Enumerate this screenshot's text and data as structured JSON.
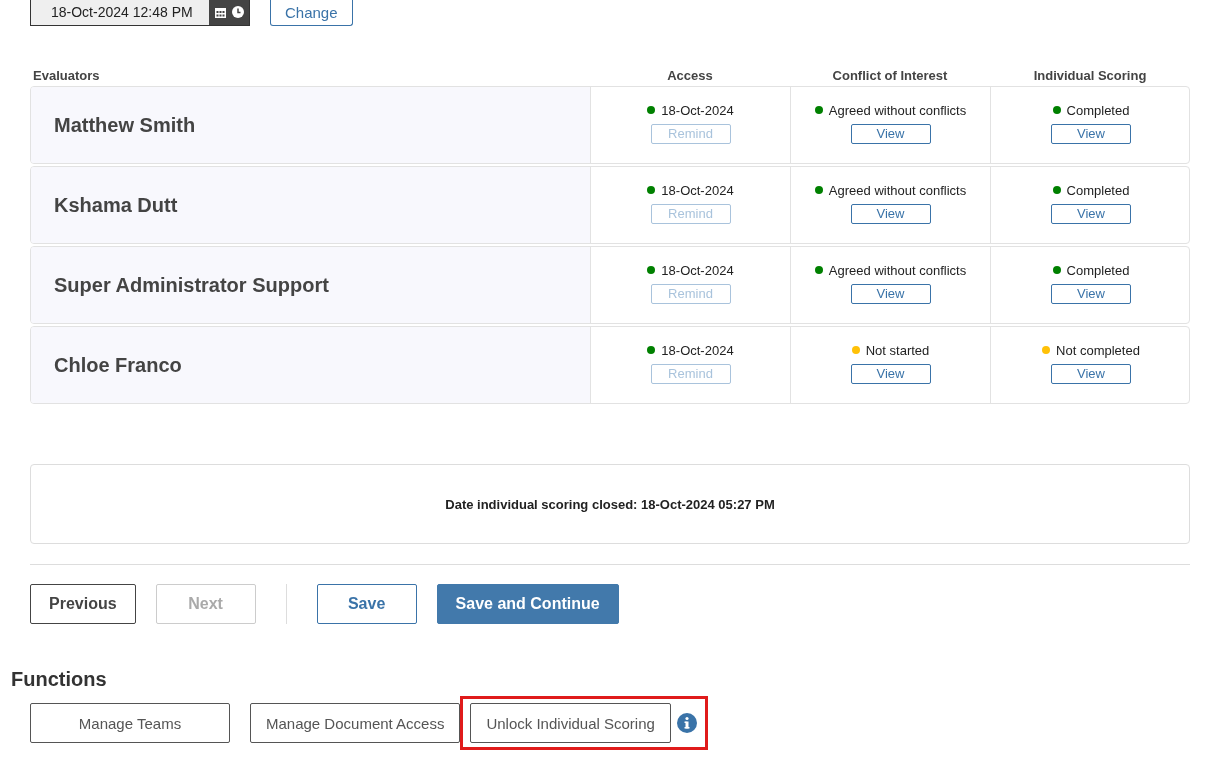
{
  "date_field": {
    "value": "18-Oct-2024 12:48 PM"
  },
  "change_button": "Change",
  "columns": [
    "Evaluators",
    "Access",
    "Conflict of Interest",
    "Individual Scoring"
  ],
  "evaluators": [
    {
      "name": "Matthew Smith",
      "access": {
        "status": "18-Oct-2024",
        "color": "#008000",
        "button": "Remind",
        "disabled": true
      },
      "conflict": {
        "status": "Agreed without conflicts",
        "color": "#008000",
        "button": "View",
        "disabled": false
      },
      "scoring": {
        "status": "Completed",
        "color": "#008000",
        "button": "View",
        "disabled": false
      }
    },
    {
      "name": "Kshama Dutt",
      "access": {
        "status": "18-Oct-2024",
        "color": "#008000",
        "button": "Remind",
        "disabled": true
      },
      "conflict": {
        "status": "Agreed without conflicts",
        "color": "#008000",
        "button": "View",
        "disabled": false
      },
      "scoring": {
        "status": "Completed",
        "color": "#008000",
        "button": "View",
        "disabled": false
      }
    },
    {
      "name": "Super Administrator Support",
      "access": {
        "status": "18-Oct-2024",
        "color": "#008000",
        "button": "Remind",
        "disabled": true
      },
      "conflict": {
        "status": "Agreed without conflicts",
        "color": "#008000",
        "button": "View",
        "disabled": false
      },
      "scoring": {
        "status": "Completed",
        "color": "#008000",
        "button": "View",
        "disabled": false
      }
    },
    {
      "name": "Chloe Franco",
      "access": {
        "status": "18-Oct-2024",
        "color": "#008000",
        "button": "Remind",
        "disabled": true
      },
      "conflict": {
        "status": "Not started",
        "color": "#ffc107",
        "button": "View",
        "disabled": false
      },
      "scoring": {
        "status": "Not completed",
        "color": "#ffc107",
        "button": "View",
        "disabled": false
      }
    }
  ],
  "summary": "Date individual scoring closed: 18-Oct-2024 05:27 PM",
  "nav_buttons": [
    {
      "label": "Previous",
      "kind": "outline",
      "disabled": false
    },
    {
      "label": "Next",
      "kind": "outline",
      "disabled": true
    },
    {
      "label": "Save",
      "kind": "secondary",
      "disabled": false
    },
    {
      "label": "Save and Continue",
      "kind": "primary",
      "disabled": false
    }
  ],
  "functions": {
    "title": "Functions",
    "buttons": [
      {
        "label": "Manage Teams"
      },
      {
        "label": "Manage Document Access"
      }
    ],
    "highlighted_button": {
      "label": "Unlock Individual Scoring",
      "info": true
    }
  }
}
